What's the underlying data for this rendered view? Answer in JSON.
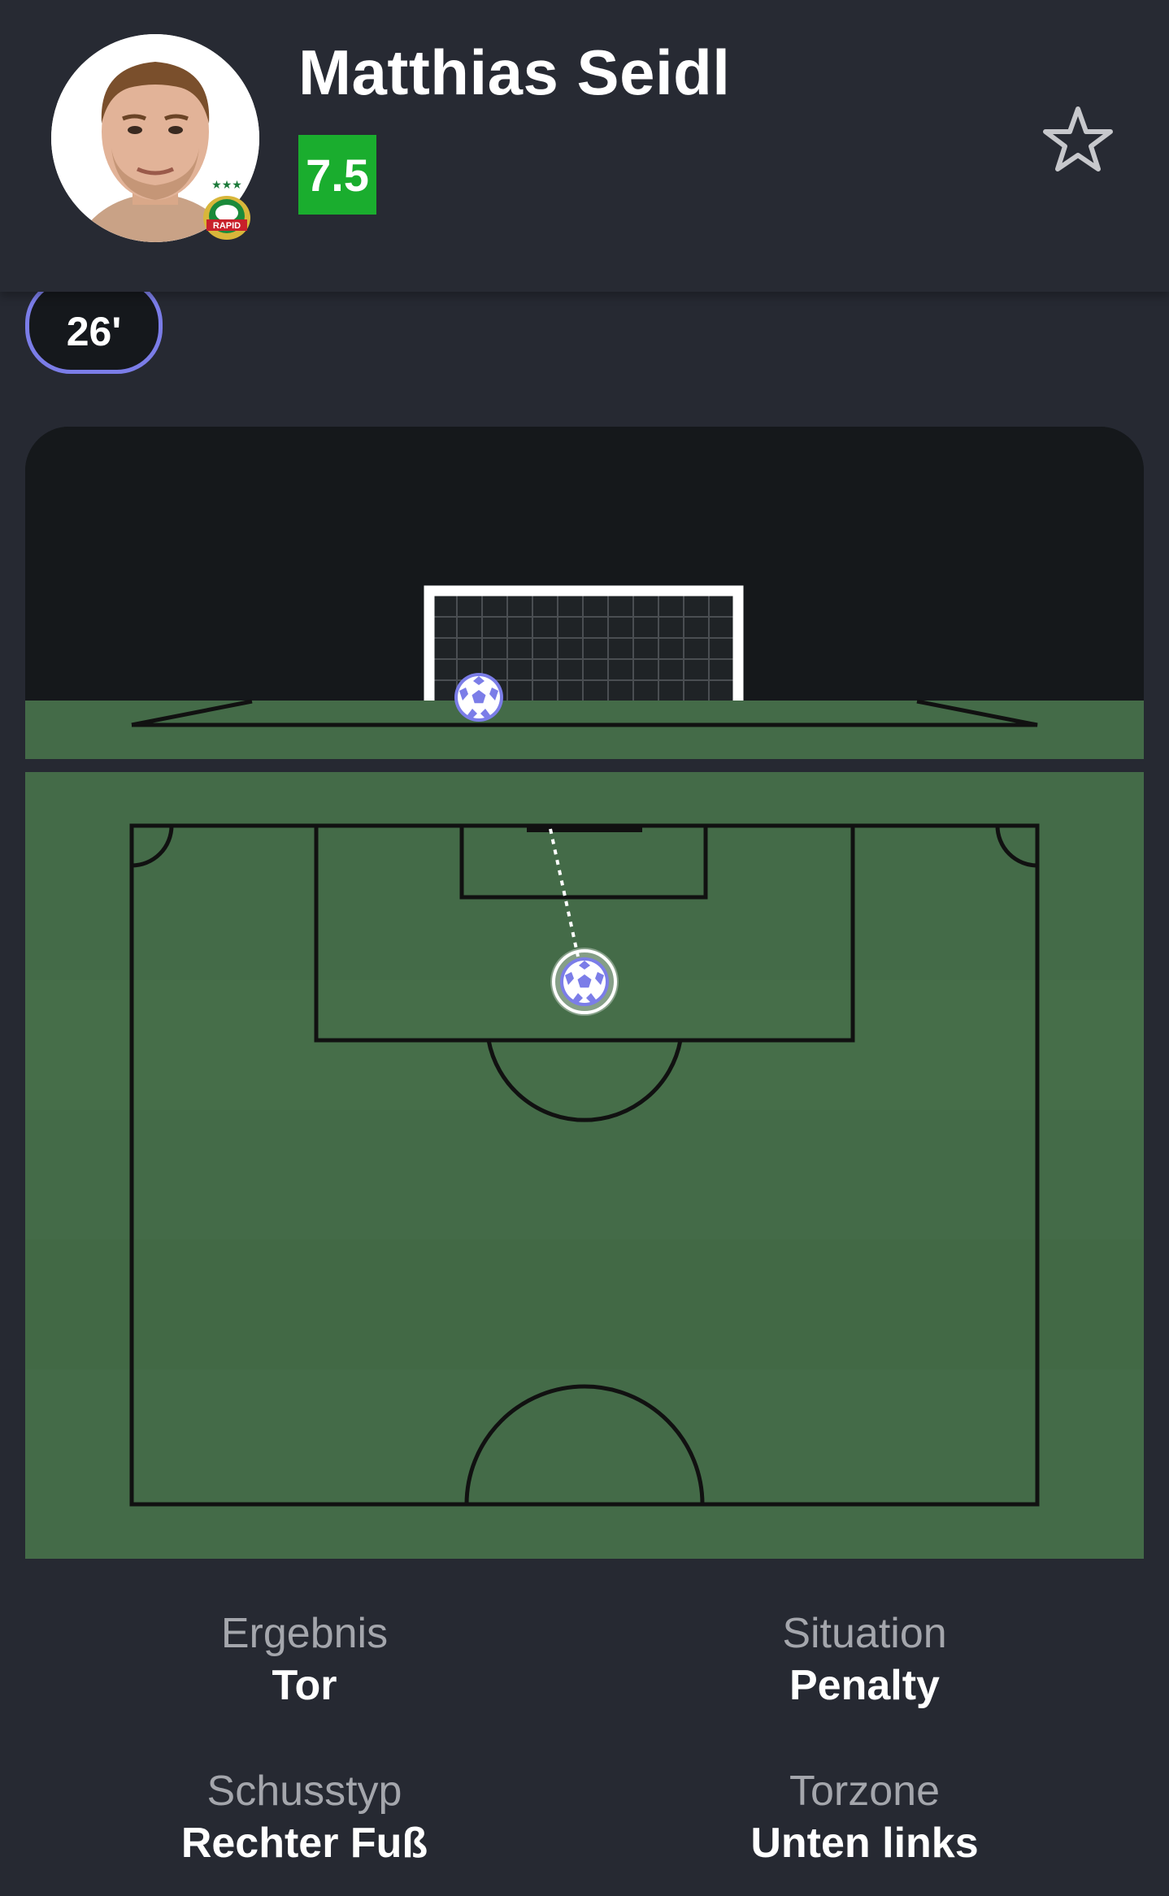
{
  "player": {
    "name": "Matthias Seidl",
    "rating": "7.5",
    "club_badge_text": "RAPID"
  },
  "shot": {
    "minute": "26'"
  },
  "stats": {
    "result_label": "Ergebnis",
    "result_value": "Tor",
    "situation_label": "Situation",
    "situation_value": "Penalty",
    "shot_type_label": "Schusstyp",
    "shot_type_value": "Rechter Fuß",
    "goal_zone_label": "Torzone",
    "goal_zone_value": "Unten links"
  },
  "colors": {
    "background": "#262932",
    "rating_badge": "#1aad2e",
    "pitch": "#446b48",
    "accent": "#7b7de8"
  },
  "icons": {
    "favorite": "star-outline-icon",
    "ball": "football-icon"
  }
}
